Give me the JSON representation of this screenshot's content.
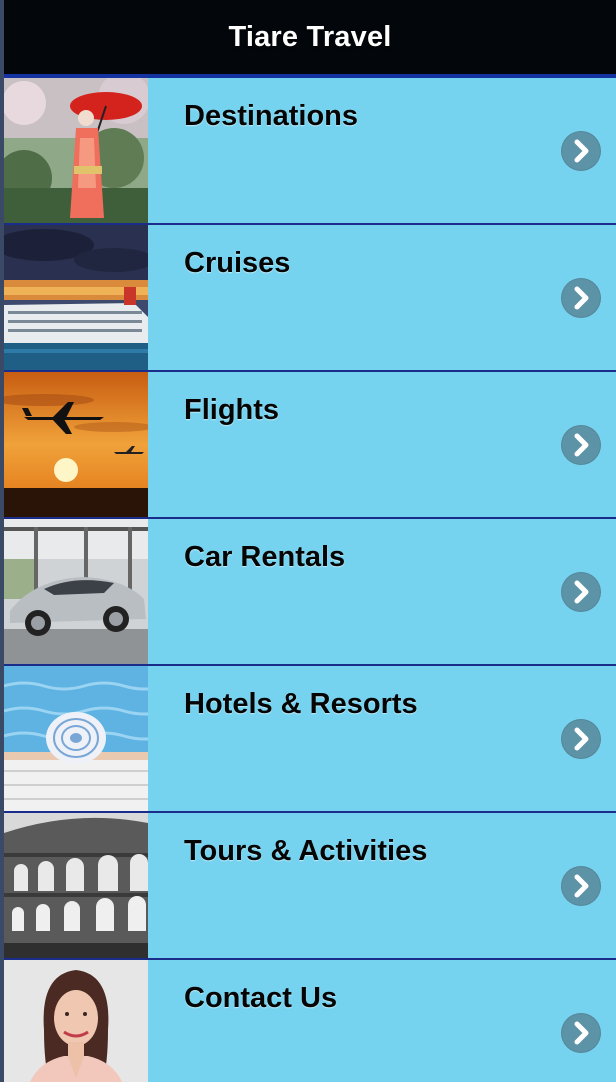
{
  "header": {
    "title": "Tiare Travel"
  },
  "menu": {
    "items": [
      {
        "label": "Destinations",
        "thumb": "geisha-red-umbrella-photo"
      },
      {
        "label": "Cruises",
        "thumb": "cruise-ship-photo"
      },
      {
        "label": "Flights",
        "thumb": "airplanes-sunset-photo"
      },
      {
        "label": "Car Rentals",
        "thumb": "silver-sports-car-photo"
      },
      {
        "label": "Hotels & Resorts",
        "thumb": "pool-sunhat-photo"
      },
      {
        "label": "Tours & Activities",
        "thumb": "colosseum-photo"
      },
      {
        "label": "Contact Us",
        "thumb": "agent-portrait-photo"
      }
    ],
    "chevron_icon": "chevron-right-icon"
  },
  "colors": {
    "header_bg": "#03070b",
    "row_bg": "#76d3f0",
    "divider": "#1a2d8a",
    "chevron_bg": "#5c93a6"
  }
}
